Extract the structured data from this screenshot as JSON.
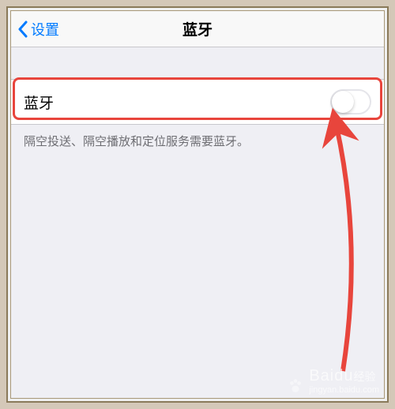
{
  "navbar": {
    "back_label": "设置",
    "title": "蓝牙"
  },
  "bluetooth": {
    "row_label": "蓝牙",
    "toggle_state": "off",
    "footer_note": "隔空投送、隔空播放和定位服务需要蓝牙。"
  },
  "watermark": {
    "brand": "Baidu",
    "brand_cn": "经验",
    "url": "jingyan.baidu.com"
  },
  "annotation": {
    "highlight_color": "#e8453c"
  }
}
